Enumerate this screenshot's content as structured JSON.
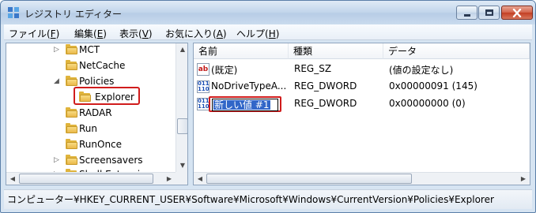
{
  "window": {
    "title": "レジストリ エディター"
  },
  "menu": [
    {
      "label": "ファイル",
      "key": "F"
    },
    {
      "label": "編集",
      "key": "E"
    },
    {
      "label": "表示",
      "key": "V"
    },
    {
      "label": "お気に入り",
      "key": "A"
    },
    {
      "label": "ヘルプ",
      "key": "H"
    }
  ],
  "tree": [
    {
      "label": "MCT",
      "expander": "closed"
    },
    {
      "label": "NetCache",
      "expander": "none"
    },
    {
      "label": "Policies",
      "expander": "open"
    },
    {
      "label": "Explorer",
      "expander": "none",
      "selected": true
    },
    {
      "label": "RADAR",
      "expander": "none"
    },
    {
      "label": "Run",
      "expander": "none"
    },
    {
      "label": "RunOnce",
      "expander": "none"
    },
    {
      "label": "Screensavers",
      "expander": "closed"
    },
    {
      "label": "Shell Extensions",
      "expander": "closed"
    }
  ],
  "list": {
    "headers": {
      "name": "名前",
      "type": "種類",
      "data": "データ"
    },
    "rows": [
      {
        "icon": "string-value-icon",
        "name": "(既定)",
        "type": "REG_SZ",
        "data": "(値の設定なし)"
      },
      {
        "icon": "binary-value-icon",
        "name": "NoDriveTypeA...",
        "type": "REG_DWORD",
        "data": "0x00000091 (145)"
      },
      {
        "icon": "binary-value-icon",
        "name": "新しい値 #1",
        "type": "REG_DWORD",
        "data": "0x00000000 (0)",
        "editing": true
      }
    ]
  },
  "status": {
    "path": "コンピューター¥HKEY_CURRENT_USER¥Software¥Microsoft¥Windows¥CurrentVersion¥Policies¥Explorer"
  },
  "colors": {
    "highlight": "#d01c1c",
    "selection": "#3166c8",
    "folder": "#eab94a"
  }
}
